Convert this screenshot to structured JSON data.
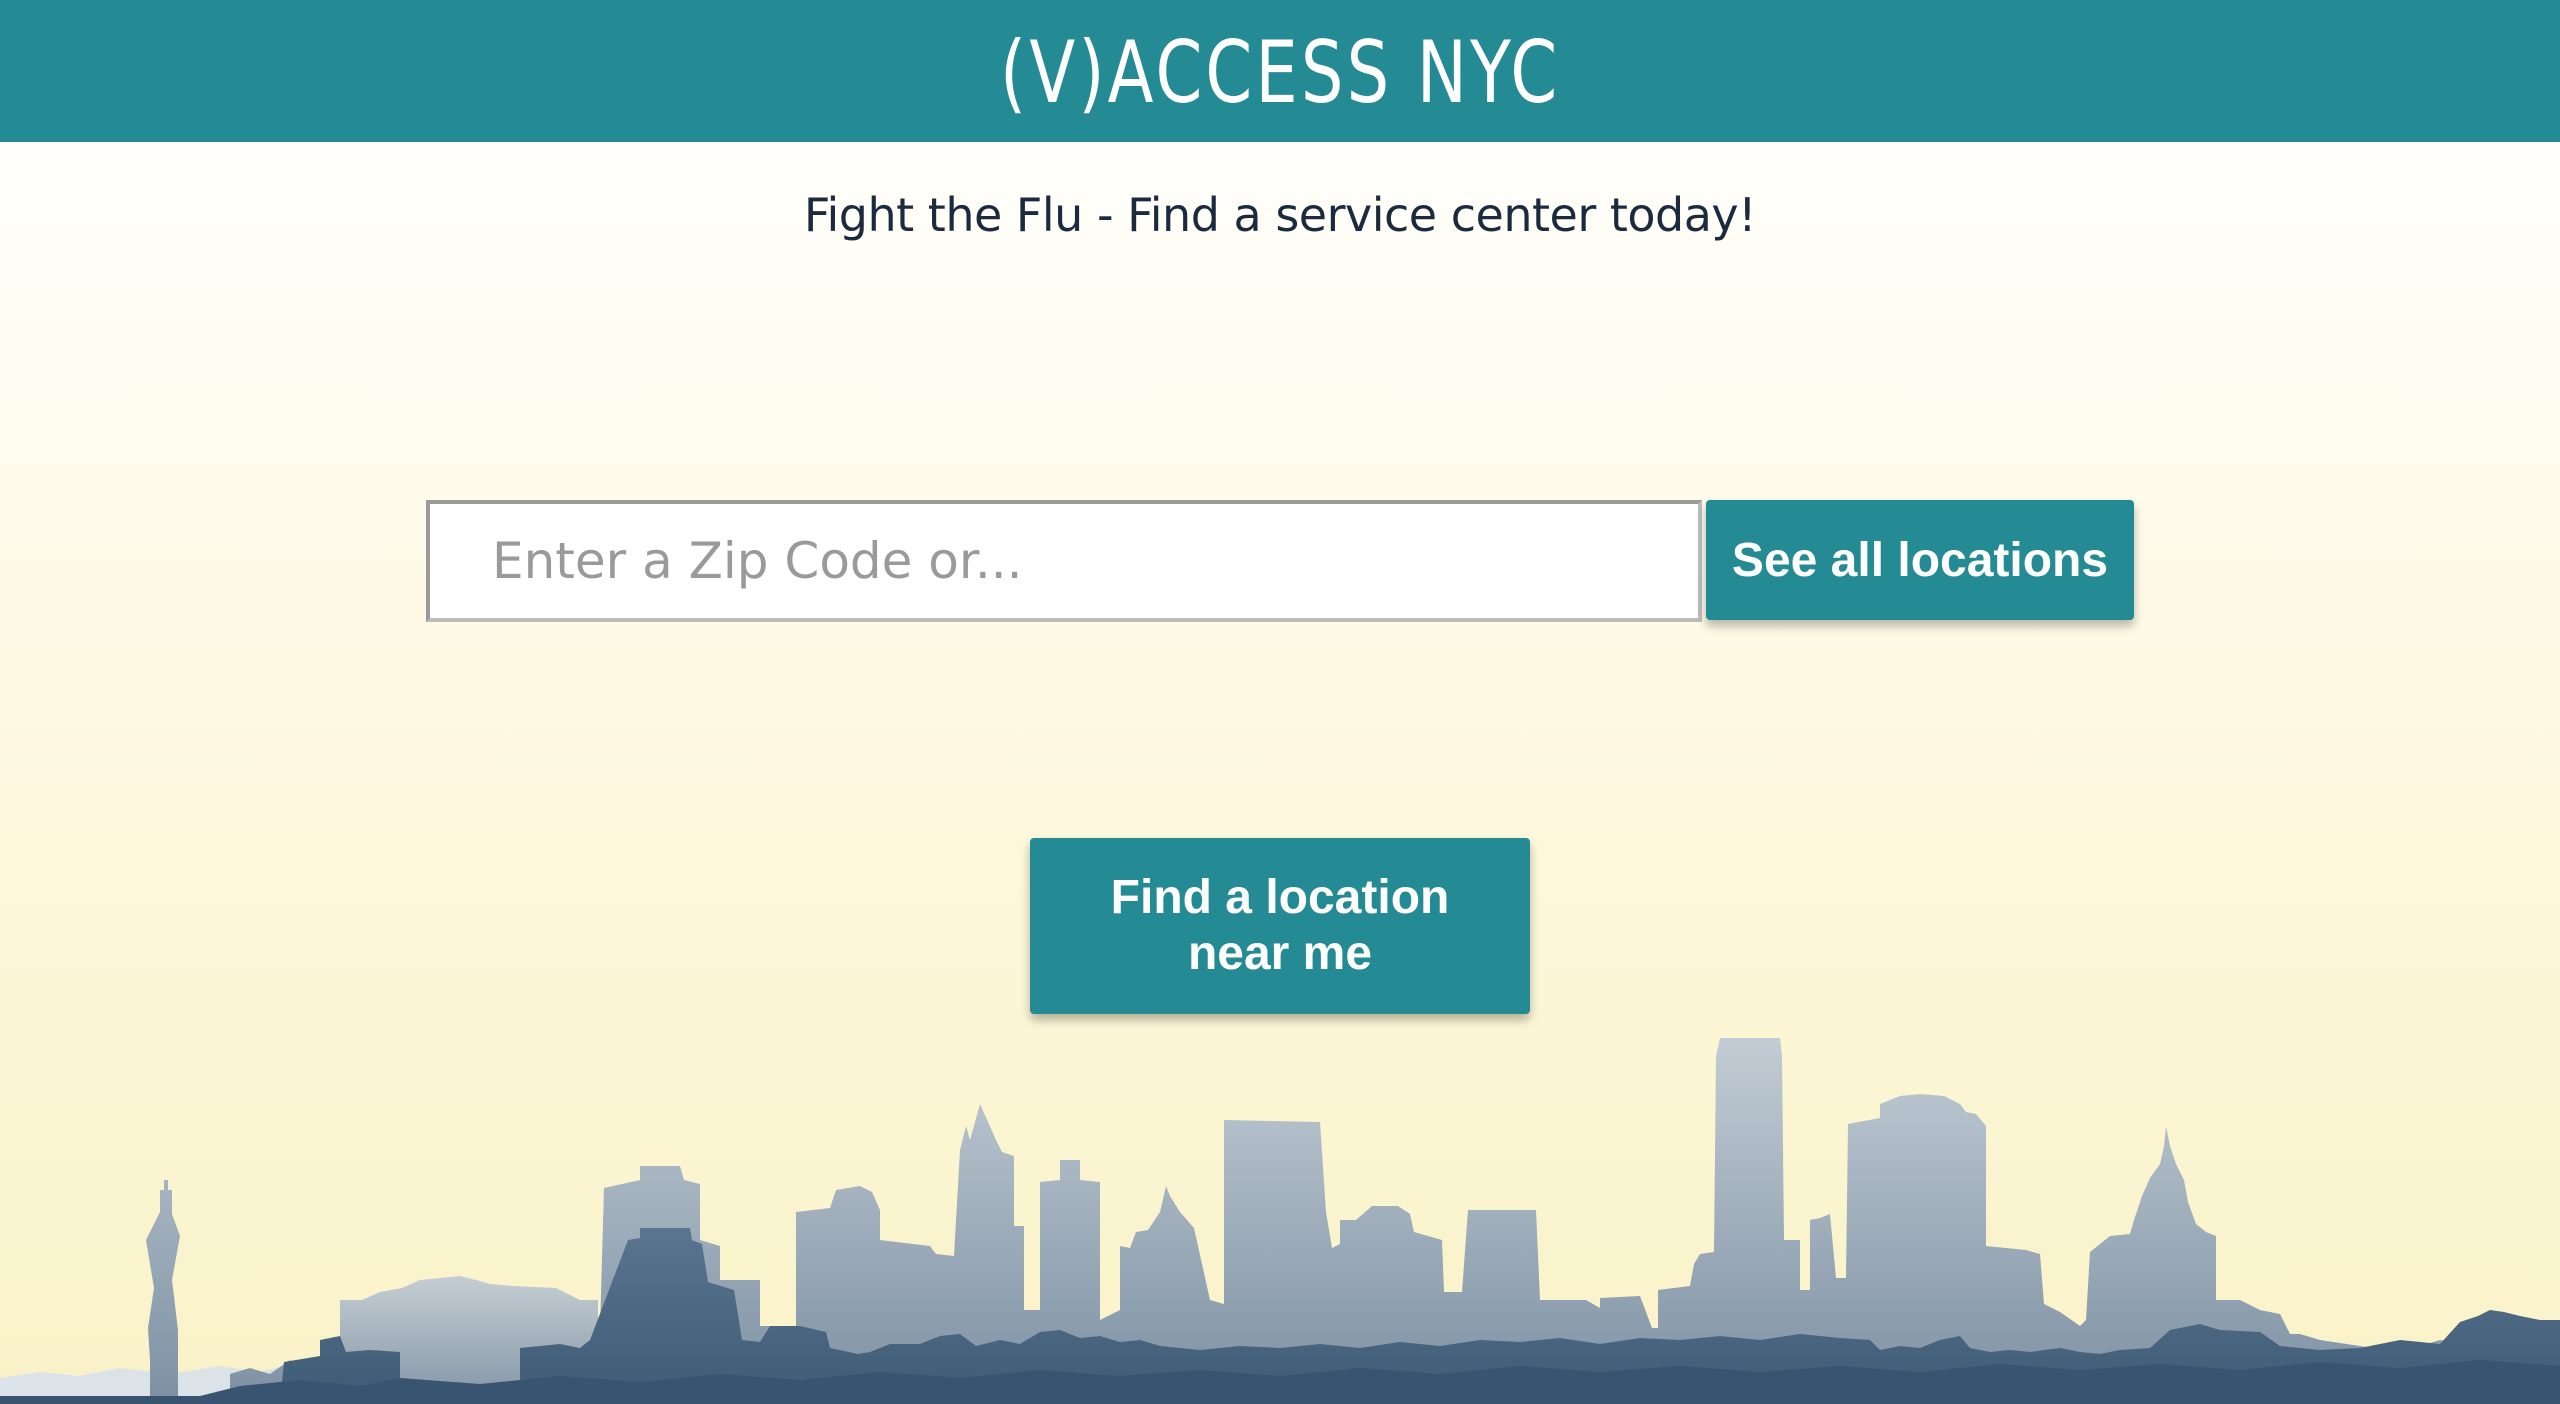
{
  "header": {
    "logo_text": "(V)ACCESS NYC",
    "background_color": "#248a94"
  },
  "main": {
    "tagline": "Fight the Flu - Find a service center today!",
    "search": {
      "placeholder": "Enter a Zip Code or...",
      "value": ""
    },
    "see_all_label": "See all locations",
    "find_near_label": "Find a location near me",
    "accent_color": "#248a94"
  },
  "footer": {
    "skyline": "nyc-skyline-silhouette"
  }
}
